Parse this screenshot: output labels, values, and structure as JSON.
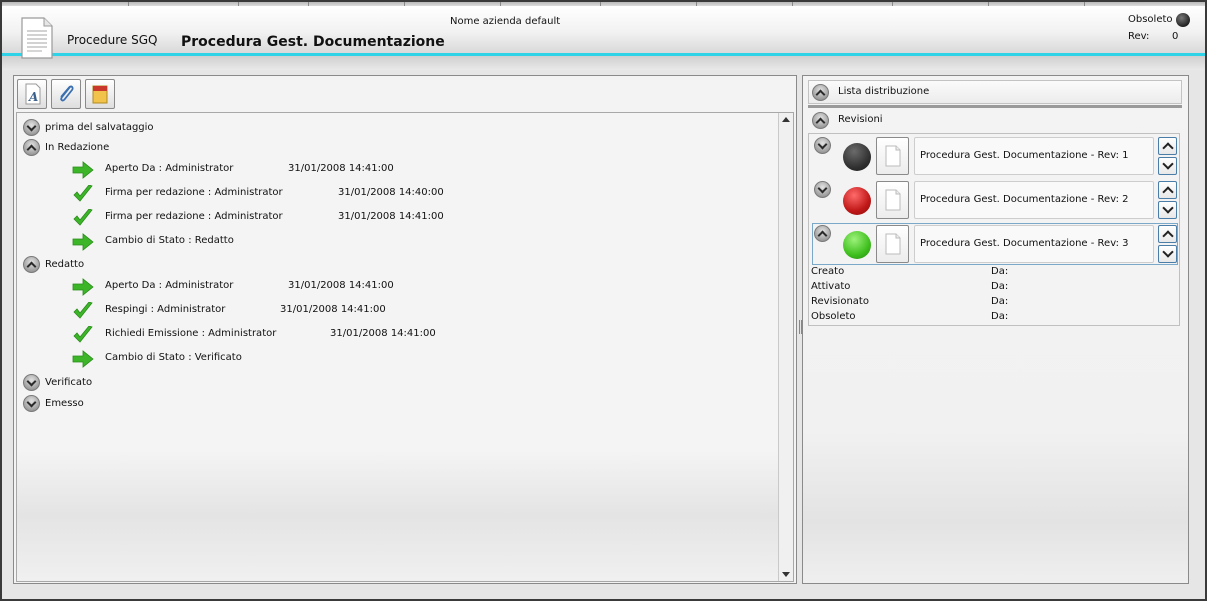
{
  "header": {
    "app_name": "Procedure SGQ",
    "page_title": "Procedura Gest. Documentazione",
    "company": "Nome azienda default",
    "obsolete_label": "Obsoleto",
    "rev_label": "Rev:",
    "rev_value": "0"
  },
  "toolbar": {
    "icons": [
      "text-format-icon",
      "paperclip-icon",
      "notepad-icon"
    ]
  },
  "tree": {
    "nodes": [
      {
        "label": "prima del salvataggio",
        "expanded": false
      },
      {
        "label": "In Redazione",
        "expanded": true
      },
      {
        "label": "Redatto",
        "expanded": true
      },
      {
        "label": "Verificato",
        "expanded": false
      },
      {
        "label": "Emesso",
        "expanded": false
      }
    ],
    "in_redazione_events": [
      {
        "icon": "arrow-right-icon",
        "text": "Aperto Da : Administrator",
        "date": "31/01/2008 14:41:00"
      },
      {
        "icon": "checkmark-icon",
        "text": "Firma per redazione : Administrator",
        "date": "31/01/2008 14:40:00"
      },
      {
        "icon": "checkmark-icon",
        "text": "Firma per redazione : Administrator",
        "date": "31/01/2008 14:41:00"
      },
      {
        "icon": "arrow-right-icon",
        "text": "Cambio di Stato : Redatto",
        "date": ""
      }
    ],
    "redatto_events": [
      {
        "icon": "arrow-right-icon",
        "text": "Aperto Da : Administrator",
        "date": "31/01/2008 14:41:00"
      },
      {
        "icon": "checkmark-icon",
        "text": "Respingi : Administrator",
        "date": "31/01/2008 14:41:00"
      },
      {
        "icon": "checkmark-icon",
        "text": "Richiedi Emissione : Administrator",
        "date": "31/01/2008 14:41:00"
      },
      {
        "icon": "arrow-right-icon",
        "text": "Cambio di Stato : Verificato",
        "date": ""
      }
    ]
  },
  "right": {
    "lista_label": "Lista distribuzione",
    "revisioni_label": "Revisioni",
    "revisions": [
      {
        "title": "Procedura Gest. Documentazione  - Rev: 1",
        "status_color": "#2e2e2e"
      },
      {
        "title": "Procedura Gest. Documentazione  - Rev: 2",
        "status_color": "#c01818"
      },
      {
        "title": "Procedura Gest. Documentazione  - Rev: 3",
        "status_color": "#3fbf1e"
      }
    ],
    "details": [
      {
        "label": "Creato",
        "da": "Da:"
      },
      {
        "label": "Attivato",
        "da": "Da:"
      },
      {
        "label": "Revisionato",
        "da": "Da:"
      },
      {
        "label": "Obsoleto",
        "da": "Da:"
      }
    ]
  }
}
